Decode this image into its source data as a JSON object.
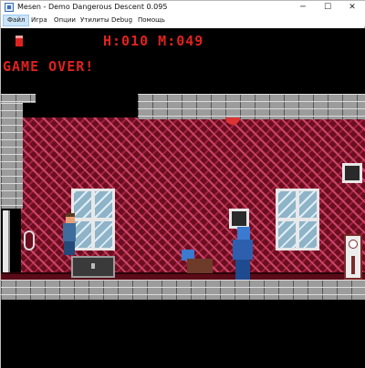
{
  "window": {
    "title": "Mesen - Demo Dangerous Descent 0.095",
    "minimize_glyph": "─",
    "maximize_glyph": "☐",
    "close_glyph": "✕"
  },
  "menu": {
    "items": [
      "Файл",
      "Игра",
      "Опции",
      "Утилиты",
      "Debug",
      "Помощь"
    ],
    "active_index": 0
  },
  "game": {
    "hud_text": "H:010 M:049",
    "status_text": "GAME OVER!",
    "lives_icon": "lives-icon"
  },
  "colors": {
    "hud_red": "#e0221f",
    "wallpaper": "#6b0e1e",
    "brick": "#9c9c9c",
    "menu_active": "#cce4f7"
  }
}
